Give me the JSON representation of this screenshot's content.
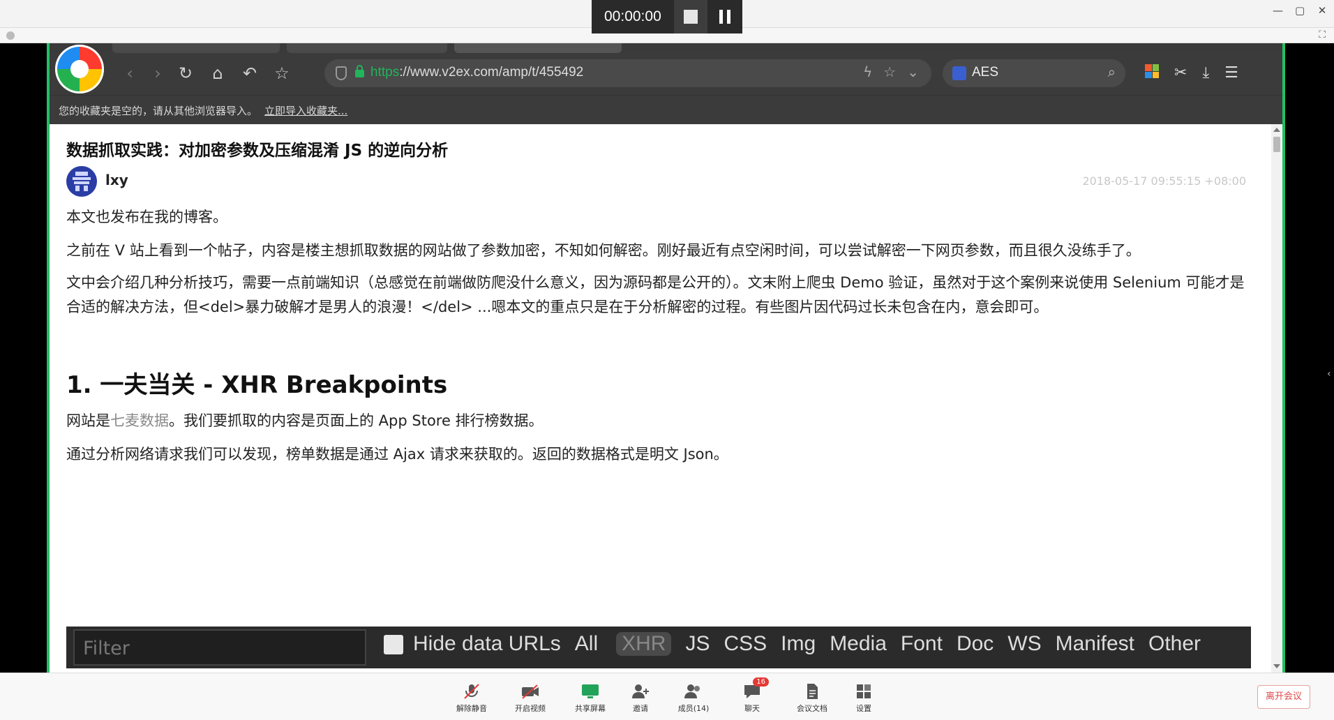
{
  "host": {
    "timer": "00:00:00",
    "window_controls": [
      "—",
      "▢",
      "✕"
    ]
  },
  "browser": {
    "url_scheme": "https",
    "url_rest": "://www.v2ex.com/amp/t/455492",
    "search_query": "AES",
    "bookmark_notice": "您的收藏夹是空的，请从其他浏览器导入。",
    "bookmark_import_link": "立即导入收藏夹..."
  },
  "article": {
    "title": "数据抓取实践：对加密参数及压缩混淆 JS 的逆向分析",
    "author": "lxy",
    "date": "2018-05-17 09:55:15 +08:00",
    "p1": "本文也发布在我的博客。",
    "p2": "之前在 V 站上看到一个帖子，内容是楼主想抓取数据的网站做了参数加密，不知如何解密。刚好最近有点空闲时间，可以尝试解密一下网页参数，而且很久没练手了。",
    "p3": "文中会介绍几种分析技巧，需要一点前端知识（总感觉在前端做防爬没什么意义，因为源码都是公开的）。文末附上爬虫 Demo 验证，虽然对于这个案例来说使用 Selenium 可能才是合适的解决方法，但<del>暴力破解才是男人的浪漫！</del> ...嗯本文的重点只是在于分析解密的过程。有些图片因代码过长未包含在内，意会即可。",
    "h1": "1. 一夫当关 - XHR Breakpoints",
    "p4_prefix": "网站是",
    "p4_link": "七麦数据",
    "p4_suffix": "。我们要抓取的内容是页面上的 App Store 排行榜数据。",
    "p5": "通过分析网络请求我们可以发现，榜单数据是通过 Ajax 请求来获取的。返回的数据格式是明文 Json。"
  },
  "devtools": {
    "filter_placeholder": "Filter",
    "hide_data_urls": "Hide data URLs",
    "types": [
      "All",
      "XHR",
      "JS",
      "CSS",
      "Img",
      "Media",
      "Font",
      "Doc",
      "WS",
      "Manifest",
      "Other"
    ],
    "selected": "XHR"
  },
  "meeting": {
    "buttons": [
      {
        "label": "解除静音",
        "icon": "mic-muted-icon"
      },
      {
        "label": "开启视频",
        "icon": "video-off-icon"
      },
      {
        "label": "共享屏幕",
        "icon": "share-screen-icon"
      },
      {
        "label": "邀请",
        "icon": "invite-icon"
      },
      {
        "label": "成员(14)",
        "icon": "members-icon"
      },
      {
        "label": "聊天",
        "icon": "chat-icon",
        "badge": "16"
      },
      {
        "label": "会议文档",
        "icon": "document-icon"
      },
      {
        "label": "设置",
        "icon": "settings-icon"
      }
    ],
    "leave_label": "离开会议"
  },
  "colors": {
    "accent_green": "#22c064",
    "toolbar": "#3b3b3b",
    "leave_red": "#e04848"
  }
}
